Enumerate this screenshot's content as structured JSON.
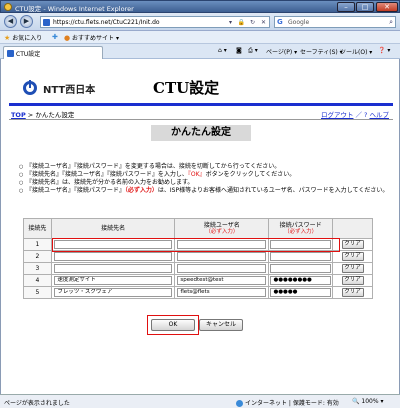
{
  "window": {
    "title": "CTU設定 - Windows Internet Explorer"
  },
  "addressbar": {
    "url": "https://ctu.flets.net/CtuC221/Init.do",
    "search_placeholder": "Google"
  },
  "favorites": {
    "favorites_label": "お気に入り",
    "suggested_label": "おすすめサイト ▾"
  },
  "tab": {
    "label": "CTU設定"
  },
  "commandbar": {
    "page": "ページ(P) ▾",
    "safety": "セーフティ(S) ▾",
    "tools": "ツール(O) ▾",
    "help": "❓ ▾"
  },
  "header": {
    "logo_text": "NTT西日本",
    "title": "CTU設定"
  },
  "breadcrumb": {
    "top": "TOP",
    "separator": " > ",
    "current": "かんたん設定"
  },
  "toplinks": {
    "logout": "ログアウト",
    "slash": "／",
    "help": "ヘルプ"
  },
  "section": {
    "heading": "かんたん設定"
  },
  "notes": [
    {
      "a": "『接続ユーザ名』『接続パスワード』を変更する場合は、接続を切断してから行ってください。",
      "b": "",
      "c": ""
    },
    {
      "a": "『接続先名』『接続ユーザ名』『接続パスワード』を入力し、",
      "b": "『OK』",
      "c": "ボタンをクリックしてください。"
    },
    {
      "a": "『接続先名』は、接続先が分かる名前の入力をお勧めします。",
      "b": "",
      "c": ""
    },
    {
      "a": "『接続ユーザ名』『接続パスワード』",
      "b": "（必ず入力）",
      "c": "は、ISP様等よりお客様へ通知されているユーザ名、パスワードを入力してください。"
    }
  ],
  "table": {
    "headers": {
      "no": "接続先",
      "name": "接続先名",
      "user": "接続ユーザ名",
      "pass": "接続パスワード",
      "required": "（必ず入力）"
    },
    "rows": [
      {
        "no": "1",
        "name": "",
        "user": "",
        "pass": "",
        "clear": "クリア"
      },
      {
        "no": "2",
        "name": "",
        "user": "",
        "pass": "",
        "clear": "クリア"
      },
      {
        "no": "3",
        "name": "",
        "user": "",
        "pass": "",
        "clear": "クリア"
      },
      {
        "no": "4",
        "name": "速度測定サイト",
        "user": "speedtest@test",
        "pass": "●●●●●●●●",
        "clear": "クリア"
      },
      {
        "no": "5",
        "name": "フレッツ・スクウェア",
        "user": "flets@flets",
        "pass": "●●●●●",
        "clear": "クリア"
      }
    ]
  },
  "buttons": {
    "ok": "OK",
    "cancel": "キャンセル"
  },
  "status": {
    "left": "ページが表示されました",
    "zone": "インターネット | 保護モード: 有効",
    "zoom": "100%"
  }
}
